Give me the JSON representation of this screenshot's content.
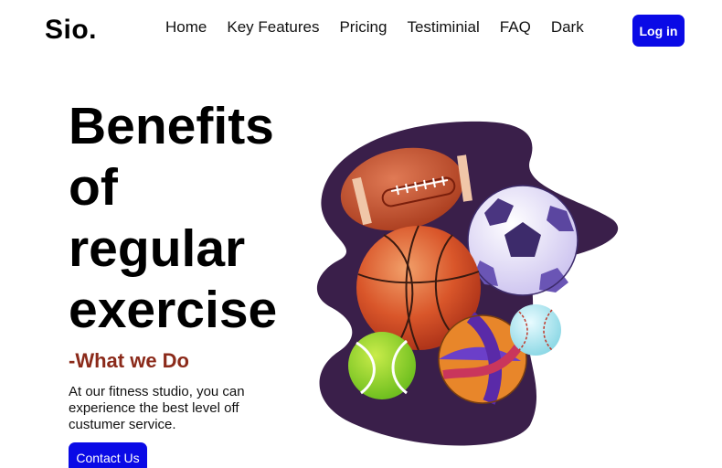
{
  "header": {
    "logo": "Sio.",
    "nav": [
      "Home",
      "Key Features",
      "Pricing",
      "Testiminial",
      "FAQ",
      "Dark"
    ],
    "login_label": "Log in"
  },
  "hero": {
    "title_lines": [
      "Benefits",
      "of",
      "regular",
      "exercise"
    ],
    "subtitle": "-What we Do",
    "description": "At our fitness studio, you can experience the best level off custumer service.",
    "contact_label": "Contact Us"
  },
  "colors": {
    "accent": "#0a0ae6",
    "subtitle": "#8b2a1a",
    "blob": "#3a1f4a"
  },
  "illustration": {
    "icons": [
      "football-icon",
      "soccer-ball-icon",
      "basketball-icon",
      "baseball-icon",
      "tennis-ball-icon",
      "volleyball-icon"
    ]
  }
}
